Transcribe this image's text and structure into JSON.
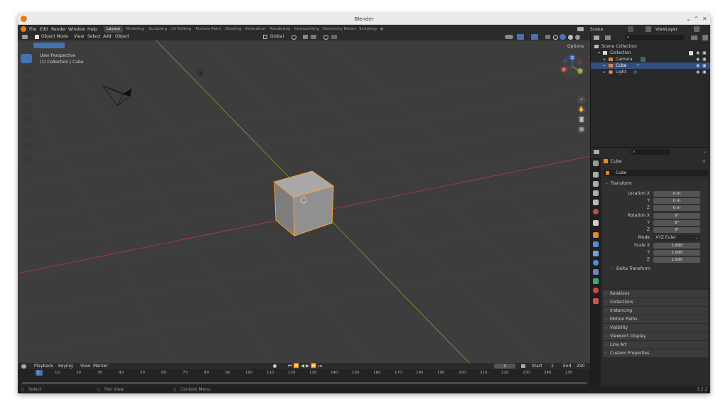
{
  "window": {
    "title": "Blender",
    "controls": [
      "⌄",
      "^",
      "✕"
    ]
  },
  "menus": [
    "File",
    "Edit",
    "Render",
    "Window",
    "Help"
  ],
  "workspaces": [
    "Layout",
    "Modeling",
    "Sculpting",
    "UV Editing",
    "Texture Paint",
    "Shading",
    "Animation",
    "Rendering",
    "Compositing",
    "Geometry Nodes",
    "Scripting"
  ],
  "active_workspace": "Layout",
  "scene": {
    "label": "Scene",
    "view_layer": "ViewLayer"
  },
  "viewport": {
    "mode": "Object Mode",
    "menu": [
      "View",
      "Select",
      "Add",
      "Object"
    ],
    "orientation": "Global",
    "perspective": "User Perspective",
    "collection_info": "(1) Collection | Cube",
    "options_label": "Options",
    "gizmo": {
      "x": "X",
      "y": "Y",
      "z": "Z"
    }
  },
  "outliner": {
    "root": "Scene Collection",
    "items": [
      {
        "name": "Collection"
      },
      {
        "name": "Camera"
      },
      {
        "name": "Cube"
      },
      {
        "name": "Light"
      }
    ]
  },
  "properties": {
    "object_name": "Cube",
    "data_name": "Cube",
    "transform_label": "Transform",
    "location_label": "Location X",
    "rotation_label": "Rotation X",
    "scale_label": "Scale X",
    "axis_y": "Y",
    "axis_z": "Z",
    "location": [
      "0 m",
      "0 m",
      "0 m"
    ],
    "rotation": [
      "0°",
      "0°",
      "0°"
    ],
    "scale": [
      "1.000",
      "1.000",
      "1.000"
    ],
    "mode_label": "Mode",
    "mode_value": "XYZ Euler",
    "delta_transform": "Delta Transform",
    "sections": [
      "Relations",
      "Collections",
      "Instancing",
      "Motion Paths",
      "Visibility",
      "Viewport Display",
      "Line Art",
      "Custom Properties"
    ]
  },
  "timeline": {
    "menu": [
      "Playback",
      "Keying",
      "View",
      "Marker"
    ],
    "current_frame": "1",
    "start_label": "Start",
    "start": "1",
    "end_label": "End",
    "end": "250",
    "ticks": [
      "1",
      "10",
      "20",
      "30",
      "40",
      "50",
      "60",
      "70",
      "80",
      "90",
      "100",
      "110",
      "120",
      "130",
      "140",
      "150",
      "160",
      "170",
      "180",
      "190",
      "200",
      "210",
      "220",
      "230",
      "240",
      "250"
    ]
  },
  "status": {
    "select": "Select",
    "pan": "Pan View",
    "context": "Context Menu",
    "version": "3.2.2"
  },
  "colors": {
    "selection": "#ffa033",
    "active_row": "#334d80",
    "x_axis": "#b33c3c",
    "y_axis": "#8b9a35",
    "accent": "#4772b3"
  }
}
